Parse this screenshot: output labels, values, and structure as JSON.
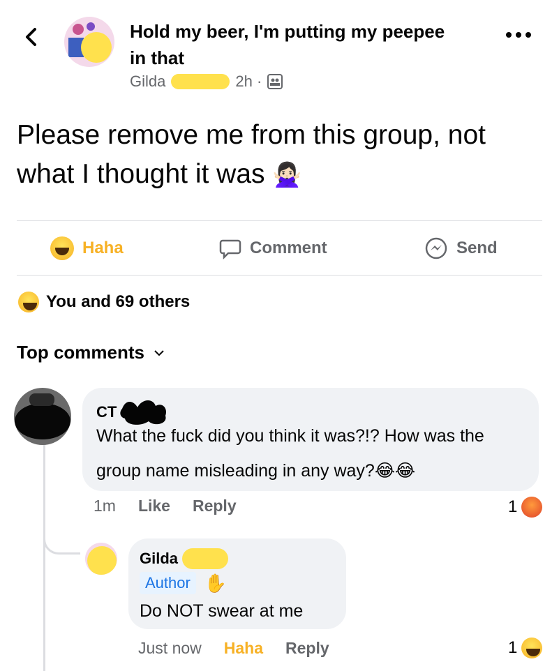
{
  "header": {
    "group_name": "Hold my beer, I'm putting my peepee in that",
    "author_first": "Gilda",
    "time": "2h ·"
  },
  "post": {
    "text": "Please remove me from this group, not what I thought it was",
    "emoji": "🙅🏻‍♀️"
  },
  "actions": {
    "haha": "Haha",
    "comment": "Comment",
    "send": "Send"
  },
  "reactions_summary": "You and 69 others",
  "top_comments_label": "Top comments",
  "comments": [
    {
      "name": "CT",
      "text": "What the fuck did you think it was?!? How was the group name misleading in any way?",
      "emoji": "😂😂",
      "time": "1m",
      "like": "Like",
      "reply": "Reply",
      "reaction_count": "1"
    }
  ],
  "reply": {
    "name": "Gilda",
    "badge": "Author",
    "text": "Do NOT swear at me",
    "time": "Just now",
    "haha": "Haha",
    "reply": "Reply",
    "reaction_count": "1"
  },
  "colors": {
    "text": "#050505",
    "muted": "#65676b",
    "haha_active": "#f7b125",
    "bubble": "#f0f2f5",
    "author_badge_bg": "#e7f3ff",
    "author_badge_text": "#1b74e4",
    "redaction": "#ffe14d"
  },
  "icons": [
    "back-chevron-icon",
    "more-dots-icon",
    "members-icon",
    "haha-icon",
    "comment-icon",
    "messenger-send-icon",
    "chevron-down-icon",
    "angry-icon",
    "waving-hand-icon"
  ]
}
